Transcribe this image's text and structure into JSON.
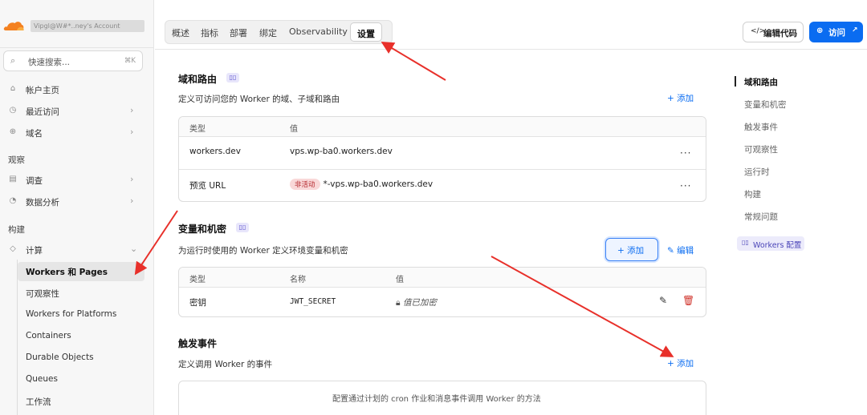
{
  "sidebar": {
    "account_name": "Vipgl@W#*..ney's Account",
    "search": {
      "placeholder": "快速搜索...",
      "shortcut": "⌘K"
    },
    "items": [
      {
        "label": "帐户主页",
        "icon": "home-icon"
      },
      {
        "label": "最近访问",
        "icon": "clock-icon"
      },
      {
        "label": "域名",
        "icon": "globe-icon"
      }
    ],
    "section_observe": "观察",
    "observe_items": [
      {
        "label": "调查",
        "icon": "investigate-icon"
      },
      {
        "label": "数据分析",
        "icon": "analytics-icon"
      }
    ],
    "section_build": "构建",
    "compute": {
      "label": "计算",
      "icon": "compute-icon"
    },
    "sub_items": [
      "Workers 和 Pages",
      "可观察性",
      "Workers for Platforms",
      "Containers",
      "Durable Objects",
      "Queues",
      "工作流"
    ]
  },
  "tabs": [
    "概述",
    "指标",
    "部署",
    "绑定",
    "Observability",
    "设置"
  ],
  "active_tab": "设置",
  "header": {
    "edit_code": "编辑代码",
    "visit": "访问"
  },
  "domains": {
    "title": "域和路由",
    "desc": "定义可访问您的 Worker 的域、子域和路由",
    "add": "+ 添加",
    "columns": [
      "类型",
      "值"
    ],
    "rows": [
      {
        "type": "workers.dev",
        "value": "vps.wp-ba0.workers.dev",
        "badge": ""
      },
      {
        "type": "预览 URL",
        "value": "*-vps.wp-ba0.workers.dev",
        "badge": "非活动"
      }
    ]
  },
  "variables": {
    "title": "变量和机密",
    "desc": "为运行时使用的 Worker 定义环境变量和机密",
    "add": "+ 添加",
    "edit": "编辑",
    "columns": [
      "类型",
      "名称",
      "值"
    ],
    "rows": [
      {
        "type": "密钥",
        "name": "JWT_SECRET",
        "value": "值已加密"
      }
    ]
  },
  "triggers": {
    "title": "触发事件",
    "desc": "定义调用 Worker 的事件",
    "add": "+ 添加",
    "empty": "配置通过计划的 cron 作业和消息事件调用 Worker 的方法"
  },
  "toc": {
    "items": [
      "域和路由",
      "变量和机密",
      "触发事件",
      "可观察性",
      "运行时",
      "构建",
      "常规问题"
    ],
    "badge": "Workers 配置"
  },
  "colors": {
    "accent": "#0a6cf1",
    "annotation": "#e8302a"
  }
}
